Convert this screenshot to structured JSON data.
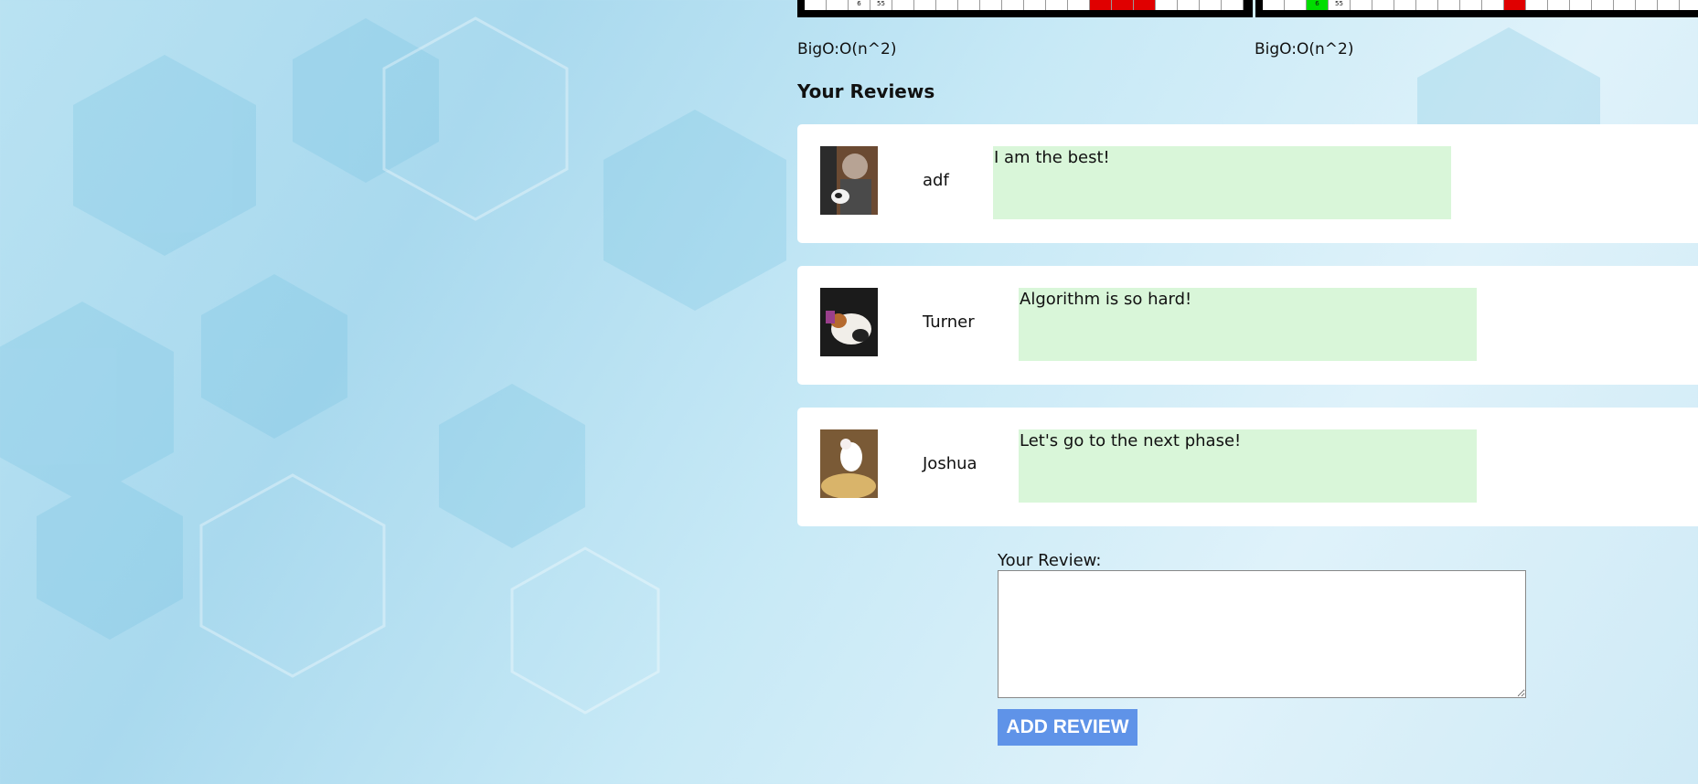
{
  "visualizers": {
    "left": {
      "cell_values": [
        "",
        "",
        "6",
        "55",
        "",
        "",
        "",
        "",
        "",
        "",
        "",
        "",
        "",
        "",
        "",
        "",
        "",
        "",
        "",
        ""
      ],
      "cell_states": [
        "",
        "",
        "",
        "",
        "",
        "",
        "",
        "",
        "",
        "",
        "",
        "",
        "",
        "red",
        "red",
        "red",
        "",
        "",
        "",
        ""
      ]
    },
    "right": {
      "cell_values": [
        "",
        "",
        "6",
        "55",
        "",
        "",
        "",
        "",
        "",
        "",
        "",
        "",
        "",
        "",
        "",
        "",
        "",
        "",
        "",
        ""
      ],
      "cell_states": [
        "",
        "",
        "green",
        "",
        "",
        "",
        "",
        "",
        "",
        "",
        "",
        "red",
        "",
        "",
        "",
        "",
        "",
        "",
        "",
        ""
      ],
      "colors": {
        "highlight_red": "#e00000",
        "highlight_green": "#00dd00"
      }
    }
  },
  "complexity": {
    "left": "BigO:O(n^2)",
    "right": "BigO:O(n^2)"
  },
  "reviews_section": {
    "title": "Your Reviews",
    "items": [
      {
        "name": "adf",
        "text": "I am the best!"
      },
      {
        "name": "Turner",
        "text": "Algorithm is so hard!"
      },
      {
        "name": "Joshua",
        "text": "Let's go to the next phase!"
      }
    ]
  },
  "review_form": {
    "label": "Your Review:",
    "value": "",
    "placeholder": "",
    "submit_label": "ADD REVIEW",
    "submit_color": "#5f93e8"
  }
}
